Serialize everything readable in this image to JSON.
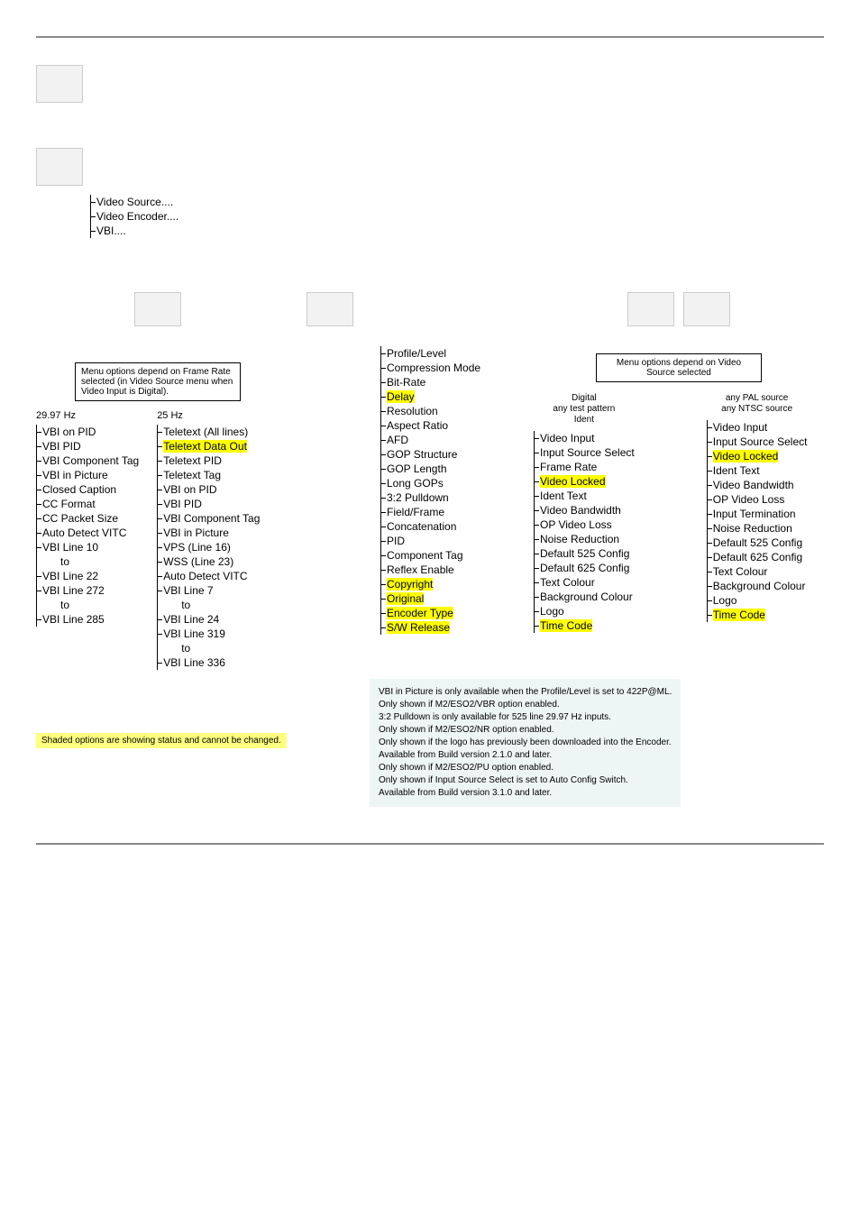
{
  "root": {
    "items": [
      "Video Source....",
      "Video Encoder....",
      "VBI...."
    ]
  },
  "vbi": {
    "note": "Menu options depend on Frame Rate selected (in Video Source menu when Video Input is Digital).",
    "left_hz": "29.97 Hz",
    "right_hz": "25 Hz",
    "left_list": [
      "VBI on PID",
      "VBI PID",
      "VBI Component Tag",
      "VBI in Picture",
      "Closed Caption",
      "CC Format",
      "CC Packet Size",
      "Auto Detect VITC",
      "VBI Line 10",
      "to",
      "VBI Line 22",
      "VBI Line 272",
      "to",
      "VBI Line 285"
    ],
    "right_list": [
      "Teletext (All lines)",
      "Teletext Data Out",
      "Teletext PID",
      "Teletext Tag",
      "VBI on PID",
      "VBI PID",
      "VBI Component Tag",
      "VBI in Picture",
      "VPS (Line 16)",
      "WSS (Line 23)",
      "Auto Detect VITC",
      "VBI Line 7",
      "to",
      "VBI Line 24",
      "VBI Line 319",
      "to",
      "VBI Line 336"
    ],
    "right_hl": {
      "1": true
    }
  },
  "encoder_list": [
    "Profile/Level",
    "Compression Mode",
    "Bit-Rate",
    "Delay",
    "Resolution",
    "Aspect Ratio",
    "AFD",
    "GOP Structure",
    "GOP Length",
    "Long GOPs",
    "3:2 Pulldown",
    "Field/Frame",
    "Concatenation",
    "PID",
    "Component Tag",
    "Reflex Enable",
    "Copyright",
    "Original",
    "Encoder Type",
    "S/W Release"
  ],
  "encoder_hl": {
    "3": true,
    "16": true,
    "17": true,
    "18": true,
    "19": true
  },
  "source": {
    "note": "Menu options depend on Video Source selected",
    "left_head": "Digital\nany test pattern\nIdent",
    "right_head": "any PAL source\nany NTSC source",
    "left_list": [
      "Video Input",
      "Input Source Select",
      "Frame Rate",
      "Video Locked",
      "Ident Text",
      "Video Bandwidth",
      "OP Video Loss",
      "Noise Reduction",
      "Default 525 Config",
      "Default 625 Config",
      "Text Colour",
      "Background Colour",
      "Logo",
      "Time Code"
    ],
    "left_hl": {
      "3": true,
      "13": true
    },
    "right_list": [
      "Video Input",
      "Input Source Select",
      "Video Locked",
      "Ident Text",
      "Video Bandwidth",
      "OP Video Loss",
      "Input Termination",
      "Noise Reduction",
      "Default 525 Config",
      "Default 625 Config",
      "Text Colour",
      "Background Colour",
      "Logo",
      "Time Code"
    ],
    "right_hl": {
      "2": true,
      "13": true
    }
  },
  "shaded_note": "Shaded options are showing status and cannot be changed.",
  "footnotes": [
    "VBI in Picture is only available when the Profile/Level is set to 422P@ML.",
    "Only shown if M2/ESO2/VBR option enabled.",
    "3:2 Pulldown is only available for 525 line 29.97 Hz inputs.",
    "Only shown if M2/ESO2/NR option enabled.",
    "Only shown if the logo has previously been downloaded into the Encoder.",
    "Available from Build version 2.1.0 and later.",
    "Only shown if M2/ESO2/PU option enabled.",
    "Only shown if Input Source Select is set to Auto Config Switch.",
    "Available from Build version 3.1.0 and later."
  ],
  "chart_data": {
    "type": "tree",
    "title": "Video menu hierarchy",
    "root": "Video",
    "children": [
      {
        "name": "Video Source",
        "children": [
          {
            "name": "Digital / any test pattern / Ident",
            "items": [
              "Video Input",
              "Input Source Select",
              "Frame Rate",
              "Video Locked",
              "Ident Text",
              "Video Bandwidth",
              "OP Video Loss",
              "Noise Reduction",
              "Default 525 Config",
              "Default 625 Config",
              "Text Colour",
              "Background Colour",
              "Logo",
              "Time Code"
            ]
          },
          {
            "name": "any PAL / NTSC source",
            "items": [
              "Video Input",
              "Input Source Select",
              "Video Locked",
              "Ident Text",
              "Video Bandwidth",
              "OP Video Loss",
              "Input Termination",
              "Noise Reduction",
              "Default 525 Config",
              "Default 625 Config",
              "Text Colour",
              "Background Colour",
              "Logo",
              "Time Code"
            ]
          }
        ]
      },
      {
        "name": "Video Encoder",
        "items": [
          "Profile/Level",
          "Compression Mode",
          "Bit-Rate",
          "Delay",
          "Resolution",
          "Aspect Ratio",
          "AFD",
          "GOP Structure",
          "GOP Length",
          "Long GOPs",
          "3:2 Pulldown",
          "Field/Frame",
          "Concatenation",
          "PID",
          "Component Tag",
          "Reflex Enable",
          "Copyright",
          "Original",
          "Encoder Type",
          "S/W Release"
        ]
      },
      {
        "name": "VBI",
        "children": [
          {
            "name": "29.97 Hz",
            "items": [
              "VBI on PID",
              "VBI PID",
              "VBI Component Tag",
              "VBI in Picture",
              "Closed Caption",
              "CC Format",
              "CC Packet Size",
              "Auto Detect VITC",
              "VBI Line 10",
              "to",
              "VBI Line 22",
              "VBI Line 272",
              "to",
              "VBI Line 285"
            ]
          },
          {
            "name": "25 Hz",
            "items": [
              "Teletext (All lines)",
              "Teletext Data Out",
              "Teletext PID",
              "Teletext Tag",
              "VBI on PID",
              "VBI PID",
              "VBI Component Tag",
              "VBI in Picture",
              "VPS (Line 16)",
              "WSS (Line 23)",
              "Auto Detect VITC",
              "VBI Line 7",
              "to",
              "VBI Line 24",
              "VBI Line 319",
              "to",
              "VBI Line 336"
            ]
          }
        ]
      }
    ]
  }
}
